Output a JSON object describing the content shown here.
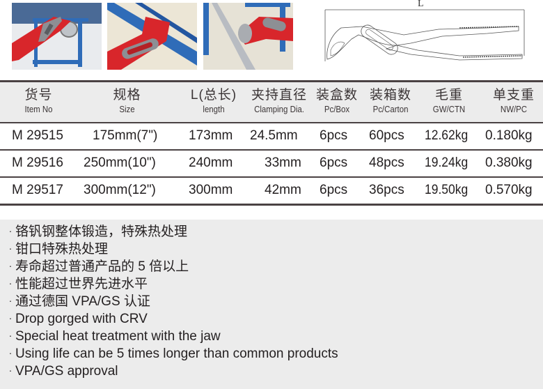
{
  "photos": [
    {
      "name": "pliers-on-pipe-factory",
      "alt": "Water pump pliers gripping pipe on blue frame"
    },
    {
      "name": "pliers-on-bolt",
      "alt": "Water pump pliers gripping hex bolt"
    },
    {
      "name": "pliers-on-rod",
      "alt": "Water pump pliers gripping rod on blue frame"
    }
  ],
  "diagram": {
    "dimension_label": "L"
  },
  "table": {
    "headers": [
      {
        "zh": "货号",
        "en": "Item No"
      },
      {
        "zh": "规格",
        "en": "Size"
      },
      {
        "zh": "L(总长)",
        "en": "length"
      },
      {
        "zh": "夹持直径",
        "en": "Clamping Dia."
      },
      {
        "zh": "装盒数",
        "en": "Pc/Box"
      },
      {
        "zh": "装箱数",
        "en": "Pc/Carton"
      },
      {
        "zh": "毛重",
        "en": "GW/CTN"
      },
      {
        "zh": "单支重",
        "en": "NW/PC"
      }
    ],
    "rows": [
      {
        "item": "M 29515",
        "size": "175mm(7\")",
        "length": "173mm",
        "clamp": "24.5mm",
        "box": "6pcs",
        "carton": "60pcs",
        "gw": "12.62kg",
        "nw": "0.180kg"
      },
      {
        "item": "M 29516",
        "size": "250mm(10\")",
        "length": "240mm",
        "clamp": "33mm",
        "box": "6pcs",
        "carton": "48pcs",
        "gw": "19.24kg",
        "nw": "0.380kg"
      },
      {
        "item": "M 29517",
        "size": "300mm(12\")",
        "length": "300mm",
        "clamp": "42mm",
        "box": "6pcs",
        "carton": "36pcs",
        "gw": "19.50kg",
        "nw": "0.570kg"
      }
    ]
  },
  "features": {
    "bullet": "·",
    "items": [
      "铬钒钢整体锻造，特殊热处理",
      "钳口特殊热处理",
      "寿命超过普通产品的 5 倍以上",
      "性能超过世界先进水平",
      "通过德国 VPA/GS 认证",
      "Drop gorged with CRV",
      "Special heat treatment with the jaw",
      "Using life can be 5 times longer than common products",
      "VPA/GS approval"
    ]
  },
  "colors": {
    "accent_red": "#d8262b",
    "frame_blue": "#2f6cb8",
    "rule_dark": "#4a4243",
    "band_gray": "#ececec"
  }
}
